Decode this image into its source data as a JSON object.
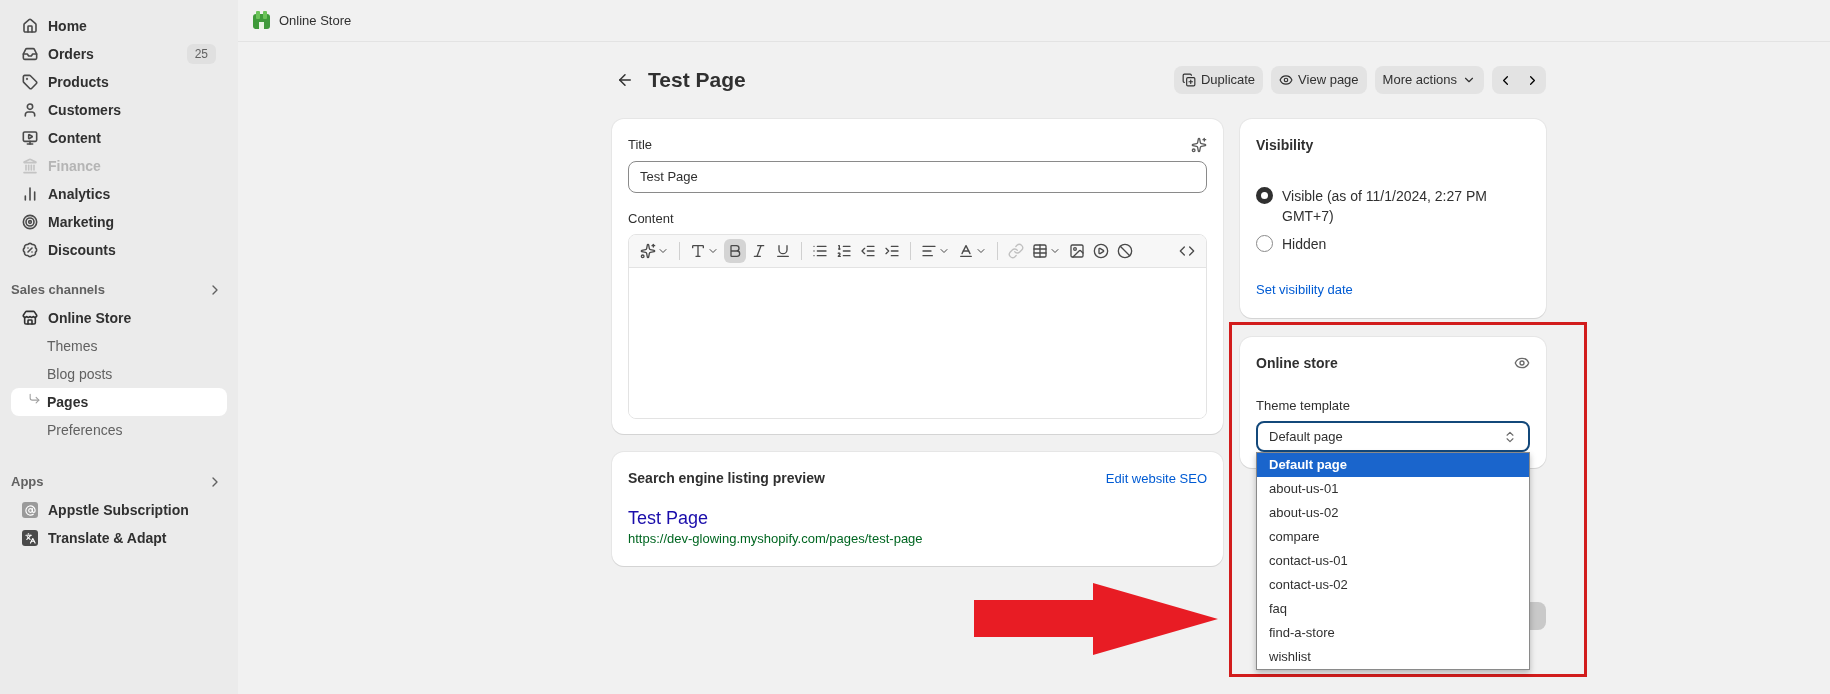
{
  "top_bar": {
    "title": "Online Store"
  },
  "sidebar": {
    "main_items": [
      {
        "label": "Home",
        "disabled": false
      },
      {
        "label": "Orders",
        "disabled": false,
        "badge": "25"
      },
      {
        "label": "Products",
        "disabled": false
      },
      {
        "label": "Customers",
        "disabled": false
      },
      {
        "label": "Content",
        "disabled": false
      },
      {
        "label": "Finance",
        "disabled": true
      },
      {
        "label": "Analytics",
        "disabled": false
      },
      {
        "label": "Marketing",
        "disabled": false
      },
      {
        "label": "Discounts",
        "disabled": false
      }
    ],
    "sales_channels": {
      "title": "Sales channels",
      "channel": {
        "label": "Online Store",
        "children": [
          {
            "label": "Themes",
            "selected": false
          },
          {
            "label": "Blog posts",
            "selected": false
          },
          {
            "label": "Pages",
            "selected": true
          },
          {
            "label": "Preferences",
            "selected": false
          }
        ]
      }
    },
    "apps": {
      "title": "Apps",
      "items": [
        {
          "label": "Appstle Subscription"
        },
        {
          "label": "Translate & Adapt"
        }
      ]
    }
  },
  "page_header": {
    "title": "Test Page",
    "actions": [
      {
        "label": "Duplicate"
      },
      {
        "label": "View page"
      },
      {
        "label": "More actions"
      }
    ]
  },
  "editor_card": {
    "title_label": "Title",
    "title_value": "Test Page",
    "content_label": "Content",
    "toolbar": {
      "bold_selected": true
    }
  },
  "seo_card": {
    "title": "Search engine listing preview",
    "link": "Edit website SEO",
    "preview_title": "Test Page",
    "preview_url": "https://dev-glowing.myshopify.com/pages/test-page"
  },
  "visibility_card": {
    "title": "Visibility",
    "options": [
      {
        "label": "Visible (as of 11/1/2024, 2:27 PM GMT+7)",
        "selected": true
      },
      {
        "label": "Hidden",
        "selected": false
      }
    ],
    "link": "Set visibility date"
  },
  "online_store_card": {
    "title": "Online store",
    "template_label": "Theme template",
    "template_value": "Default page",
    "dropdown_open": true,
    "options": [
      {
        "label": "Default page",
        "selected": true
      },
      {
        "label": "about-us-01",
        "selected": false
      },
      {
        "label": "about-us-02",
        "selected": false
      },
      {
        "label": "compare",
        "selected": false
      },
      {
        "label": "contact-us-01",
        "selected": false
      },
      {
        "label": "contact-us-02",
        "selected": false
      },
      {
        "label": "faq",
        "selected": false
      },
      {
        "label": "find-a-store",
        "selected": false
      },
      {
        "label": "wishlist",
        "selected": false
      }
    ]
  },
  "save_button": {
    "disabled": true
  },
  "annotations": {
    "highlight_frame": true,
    "arrow": true
  }
}
